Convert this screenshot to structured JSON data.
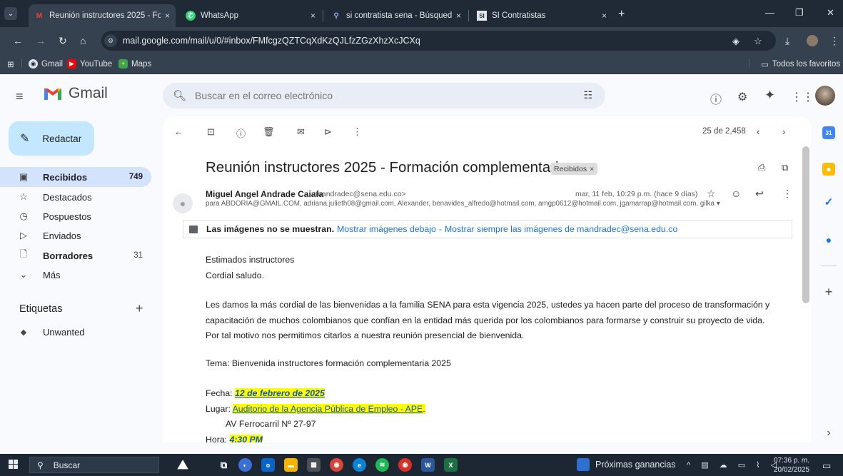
{
  "browser": {
    "tabs": [
      {
        "title": "Reunión instructores 2025 - For",
        "close": "×"
      },
      {
        "title": "WhatsApp",
        "close": "×"
      },
      {
        "title": "si contratista sena - Búsqueda",
        "close": "×"
      },
      {
        "title": "SI Contratistas",
        "close": "×"
      }
    ],
    "new_tab": "+",
    "url": "mail.google.com/mail/u/0/#inbox/FMfcgzQZTCqXdKzQJLfzZGzXhzXcJCXq",
    "bookmarks": [
      "Gmail",
      "YouTube",
      "Maps"
    ],
    "all_bookmarks": "Todos los favoritos"
  },
  "gmail": {
    "product": "Gmail",
    "search_placeholder": "Buscar en el correo electrónico",
    "compose_label": "Redactar",
    "nav": [
      {
        "label": "Recibidos",
        "count": "749"
      },
      {
        "label": "Destacados",
        "count": ""
      },
      {
        "label": "Pospuestos",
        "count": ""
      },
      {
        "label": "Enviados",
        "count": ""
      },
      {
        "label": "Borradores",
        "count": "31"
      },
      {
        "label": "Más",
        "count": ""
      }
    ],
    "labels_header": "Etiquetas",
    "labels": [
      "Unwanted"
    ],
    "pager": "25 de 2,458"
  },
  "email": {
    "subject": "Reunión instructores 2025 - Formación complementaria",
    "chip": "Recibidos",
    "sender_name": "Miguel Angel Andrade Caiafa",
    "sender_email": "<mandradec@sena.edu.co>",
    "date": "mar, 11 feb, 10:29 p.m. (hace 9 días)",
    "to": "para ABDORIA@GMAIL.COM, adriana.julieth08@gmail.com, Alexander, benavides_alfredo@hotmail.com, amgp0612@hotmail.com, jgamarrap@hotmail.com, gilka",
    "images_notice": "Las imágenes no se muestran.",
    "show_below": "Mostrar imágenes debajo",
    "images_separator": "-",
    "show_always": "Mostrar siempre las imágenes de mandradec@sena.edu.co",
    "greeting1": "Estimados instructores",
    "greeting2": "Cordial saludo.",
    "para_line1": "Les damos la más cordial de las bienvenidas a la familia SENA para esta vigencia 2025, ustedes ya hacen parte del proceso de transformación y",
    "para_line2": "capacitación de muchos colombianos que confían en la entidad más querida por los colombianos para formarse y construir su proyecto de vida.",
    "para_line3": "Por tal motivo nos permitimos citarlos a nuestra reunión presencial de bienvenida.",
    "tema": "Tema: Bienvenida instructores formación complementaria 2025",
    "fecha_label": "Fecha: ",
    "fecha_value": "12 de febrero de 2025",
    "lugar_label": "Lugar: ",
    "lugar_value": "Auditorio de la Agencia Pública de Empleo - APE",
    "lugar_end": ".",
    "address": "AV Ferrocarril Nº 27-97",
    "hora_label": "Hora: ",
    "hora_value": "4:30 PM"
  },
  "taskbar": {
    "search": "Buscar",
    "weather": "Próximas ganancias",
    "time": "07:36 p. m.",
    "date": "20/02/2025"
  },
  "colors": {
    "compose_bg": "#c2e7ff",
    "active_nav": "#d3e3fd",
    "link": "#1a73e8",
    "highlight": "#ffff00"
  }
}
